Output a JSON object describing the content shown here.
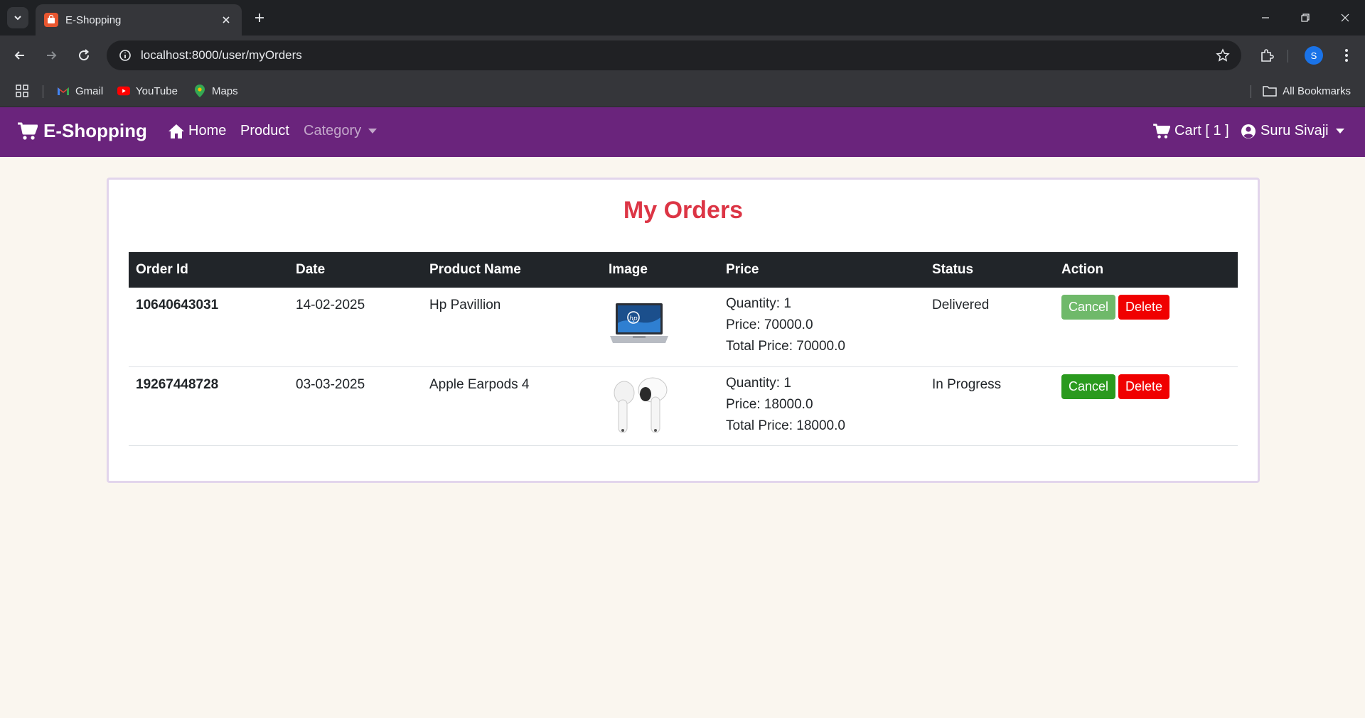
{
  "browser": {
    "tab_title": "E-Shopping",
    "url": "localhost:8000/user/myOrders",
    "profile_initial": "S",
    "bookmarks": [
      {
        "label": "Gmail",
        "icon": "gmail-icon"
      },
      {
        "label": "YouTube",
        "icon": "youtube-icon"
      },
      {
        "label": "Maps",
        "icon": "maps-icon"
      }
    ],
    "all_bookmarks_label": "All Bookmarks"
  },
  "navbar": {
    "brand": "E-Shopping",
    "home": "Home",
    "product": "Product",
    "category": "Category",
    "cart": "Cart [ 1 ]",
    "user": "Suru Sivaji",
    "color": "#6a247c"
  },
  "orders": {
    "title": "My Orders",
    "headers": [
      "Order Id",
      "Date",
      "Product Name",
      "Image",
      "Price",
      "Status",
      "Action"
    ],
    "rows": [
      {
        "order_id": "10640643031",
        "date": "14-02-2025",
        "product_name": "Hp Pavillion",
        "image_icon": "laptop-image",
        "quantity": "Quantity: 1",
        "price": "Price: 70000.0",
        "total": "Total Price: 70000.0",
        "status": "Delivered",
        "cancel_label": "Cancel",
        "cancel_disabled": true,
        "delete_label": "Delete"
      },
      {
        "order_id": "19267448728",
        "date": "03-03-2025",
        "product_name": "Apple Earpods 4",
        "image_icon": "earbuds-image",
        "quantity": "Quantity: 1",
        "price": "Price: 18000.0",
        "total": "Total Price: 18000.0",
        "status": "In Progress",
        "cancel_label": "Cancel",
        "cancel_disabled": false,
        "delete_label": "Delete"
      }
    ]
  }
}
